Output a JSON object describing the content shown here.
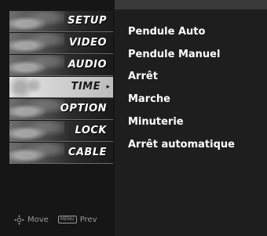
{
  "menu": {
    "items": [
      {
        "label": "SETUP"
      },
      {
        "label": "VIDEO"
      },
      {
        "label": "AUDIO"
      },
      {
        "label": "TIME",
        "arrow": "▸"
      },
      {
        "label": "OPTION"
      },
      {
        "label": "LOCK"
      },
      {
        "label": "CABLE"
      }
    ],
    "selected_index": 3
  },
  "submenu": {
    "items": [
      {
        "label": "Pendule Auto"
      },
      {
        "label": "Pendule Manuel"
      },
      {
        "label": "Arrêt"
      },
      {
        "label": "Marche"
      },
      {
        "label": "Minuterie"
      },
      {
        "label": "Arrêt automatique"
      }
    ]
  },
  "footer": {
    "move_label": "Move",
    "menu_key": "MENU",
    "prev_label": "Prev"
  },
  "colors": {
    "panel": "#161616",
    "submenu_bg": "#1e1e1e",
    "selected": "#d6d6d6",
    "text": "#ffffff"
  }
}
